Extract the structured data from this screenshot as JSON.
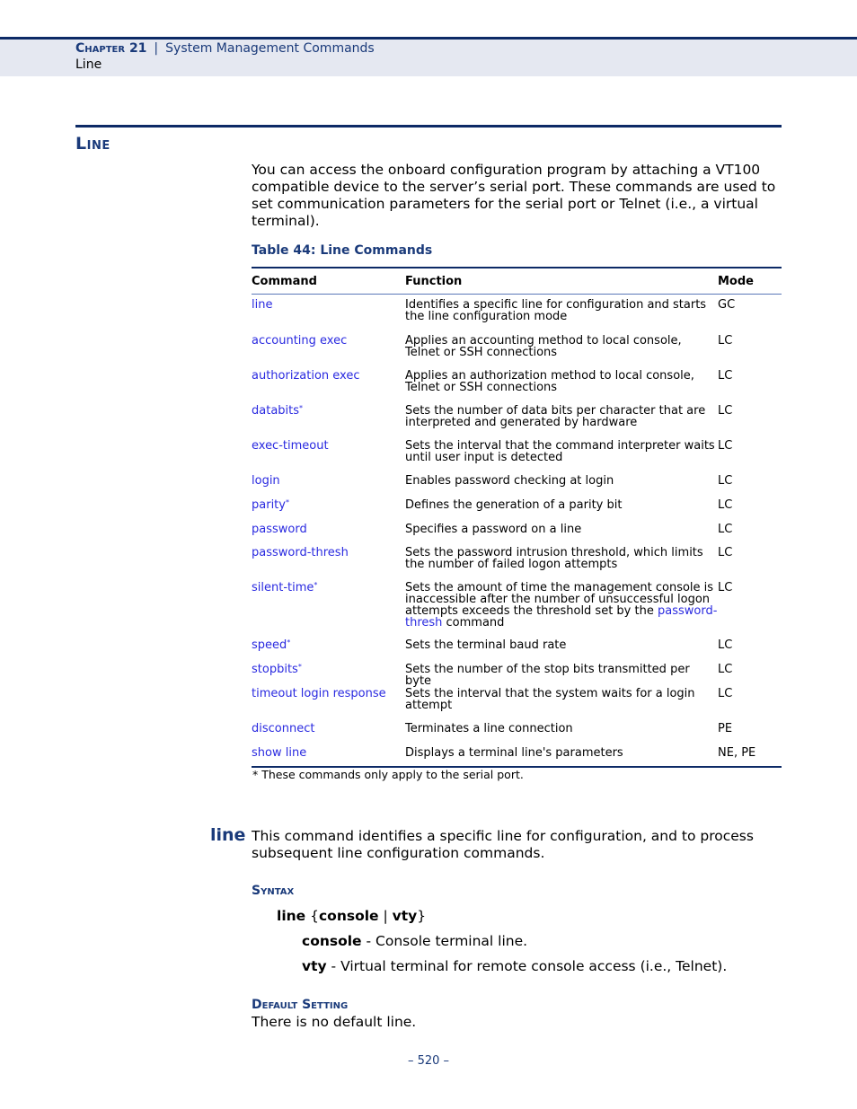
{
  "header": {
    "chapter": "Chapter 21",
    "separator": "|",
    "chapter_title": "System Management Commands",
    "section": "Line"
  },
  "section": {
    "title": "Line",
    "intro": "You can access the onboard configuration program by attaching a VT100 compatible device to the server’s serial port. These commands are used to set communication parameters for the serial port or Telnet (i.e., a virtual terminal)."
  },
  "table": {
    "caption": "Table 44: Line Commands",
    "headers": [
      "Command",
      "Function",
      "Mode"
    ],
    "rows": [
      {
        "command": "line",
        "asterisk": "",
        "function": "Identifies a specific line for configuration and starts the line configuration mode",
        "mode": "GC"
      },
      {
        "command": "accounting exec",
        "asterisk": "",
        "function": "Applies an accounting method to local console, Telnet or SSH connections",
        "mode": "LC"
      },
      {
        "command": "authorization exec",
        "asterisk": "",
        "function": "Applies an authorization method to local console, Telnet or SSH connections",
        "mode": "LC"
      },
      {
        "command": "databits",
        "asterisk": "*",
        "function": "Sets the number of data bits per character that are interpreted and generated by hardware",
        "mode": "LC"
      },
      {
        "command": "exec-timeout",
        "asterisk": "",
        "function": "Sets the interval that the command interpreter waits until user input is detected",
        "mode": "LC"
      },
      {
        "command": "login",
        "asterisk": "",
        "function": "Enables password checking at login",
        "mode": "LC"
      },
      {
        "command": "parity",
        "asterisk": "*",
        "function": "Defines the generation of a parity bit",
        "mode": "LC"
      },
      {
        "command": "password",
        "asterisk": "",
        "function": "Specifies a password on a line",
        "mode": "LC"
      },
      {
        "command": "password-thresh",
        "asterisk": "",
        "function": "Sets the password intrusion threshold, which limits the number of failed logon attempts",
        "mode": "LC"
      },
      {
        "command": "silent-time",
        "asterisk": "*",
        "function_pre": "Sets the amount of time the management console is inaccessible after the number of unsuccessful logon attempts exceeds the threshold set by the ",
        "function_link": "password-thresh",
        "function_post": " command",
        "mode": "LC"
      },
      {
        "command": "speed",
        "asterisk": "*",
        "function": "Sets the terminal baud rate",
        "mode": "LC"
      },
      {
        "command": "stopbits",
        "asterisk": "*",
        "function": "Sets the number of the stop bits transmitted per byte",
        "mode": "LC"
      },
      {
        "command": "timeout login response",
        "asterisk": "",
        "function": "Sets the interval that the system waits for a login attempt",
        "mode": "LC"
      },
      {
        "command": "disconnect",
        "asterisk": "",
        "function": "Terminates a line connection",
        "mode": "PE"
      },
      {
        "command": "show line",
        "asterisk": "",
        "function": "Displays a terminal line's parameters",
        "mode": "NE, PE"
      }
    ],
    "footnote": "*  These commands only apply to the serial port."
  },
  "command": {
    "name": "line",
    "description": "This command identifies a specific line for configuration, and to process subsequent line configuration commands.",
    "syntax_heading": "Syntax",
    "syntax": {
      "kw": "line",
      "open": " {",
      "opt1": "console",
      "bar": " | ",
      "opt2": "vty",
      "close": "}"
    },
    "params": [
      {
        "name": "console",
        "desc": " - Console terminal line."
      },
      {
        "name": "vty",
        "desc": " - Virtual terminal for remote console access (i.e., Telnet)."
      }
    ],
    "default_heading": "Default Setting",
    "default_text": "There is no default line."
  },
  "footer": {
    "page": "–  520  –"
  }
}
